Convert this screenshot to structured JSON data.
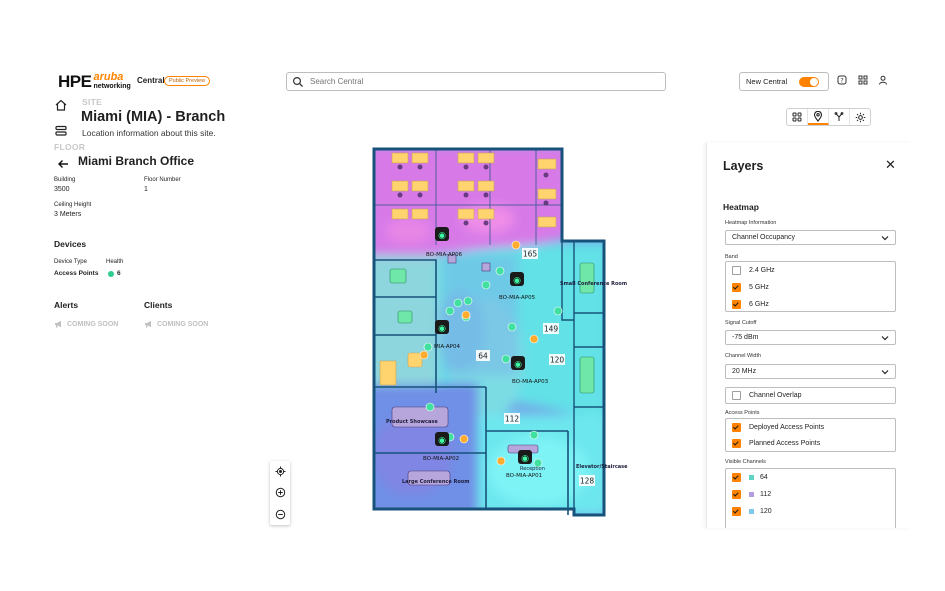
{
  "header": {
    "brand_hpe": "HPE",
    "brand_aruba": "aruba",
    "brand_networking": "networking",
    "product": "Central",
    "preview_badge": "Public Preview",
    "search_placeholder": "Search Central",
    "new_central_label": "New Central",
    "new_central_enabled": true
  },
  "site": {
    "caption": "SITE",
    "title": "Miami (MIA) - Branch",
    "description": "Location information about this site."
  },
  "floor": {
    "caption": "FLOOR",
    "title": "Miami Branch Office",
    "building_label": "Building",
    "building_value": "3500",
    "floor_number_label": "Floor Number",
    "floor_number_value": "1",
    "ceiling_label": "Ceiling Height",
    "ceiling_value": "3 Meters"
  },
  "devices": {
    "title": "Devices",
    "type_label": "Device Type",
    "health_label": "Health",
    "row_type": "Access Points",
    "row_count": "6",
    "health_color": "#2ecc8f"
  },
  "alerts": {
    "title": "Alerts",
    "status": "COMING SOON"
  },
  "clients": {
    "title": "Clients",
    "status": "COMING SOON"
  },
  "map": {
    "aps": [
      {
        "name": "BO-MIA-AP06"
      },
      {
        "name": "BO-MIA-AP05"
      },
      {
        "name": "MIA-AP04"
      },
      {
        "name": "BO-MIA-AP03"
      },
      {
        "name": "BO-MIA-AP02"
      },
      {
        "name": "BO-MIA-AP01"
      }
    ],
    "channel_tags": [
      "165",
      "149",
      "64",
      "120",
      "112",
      "128"
    ],
    "rooms": {
      "small_conference": "Small Conference Room",
      "product_showcase": "Product Showcase",
      "large_conference": "Large Conference Room",
      "reception": "Reception",
      "elevator": "Elevator/Staircase"
    },
    "colors": {
      "accent": "#ff8300",
      "wall": "#17527a",
      "magenta": "#d86be6",
      "cyan": "#66e8ee",
      "blue": "#6f9be8"
    }
  },
  "layers": {
    "title": "Layers",
    "heatmap_title": "Heatmap",
    "heatmap_info_label": "Heatmap Information",
    "heatmap_info_value": "Channel Occupancy",
    "band_label": "Band",
    "bands": [
      {
        "label": "2.4 GHz",
        "checked": false
      },
      {
        "label": "5 GHz",
        "checked": true
      },
      {
        "label": "6 GHz",
        "checked": true
      }
    ],
    "signal_cutoff_label": "Signal Cutoff",
    "signal_cutoff_value": "-75 dBm",
    "channel_width_label": "Channel Width",
    "channel_width_value": "20 MHz",
    "channel_overlap_label": "Channel Overlap",
    "access_points_label": "Access Points",
    "deployed_label": "Deployed Access Points",
    "planned_label": "Planned Access Points",
    "visible_channels_label": "Visible Channels",
    "channels": [
      {
        "label": "64",
        "color": "#5fd3c4"
      },
      {
        "label": "112",
        "color": "#b59be0"
      },
      {
        "label": "120",
        "color": "#7ec8ee"
      }
    ]
  }
}
